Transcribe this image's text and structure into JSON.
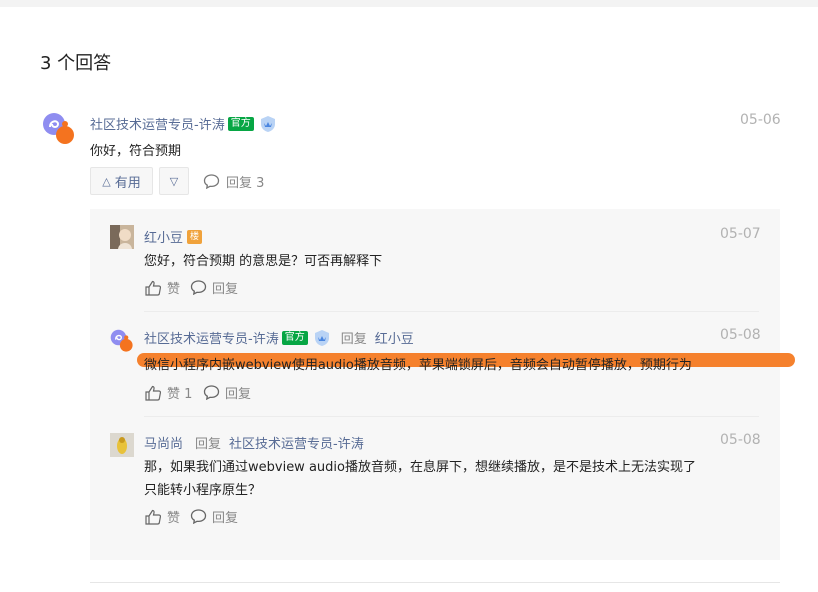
{
  "header": {
    "answer_count": "3 个回答"
  },
  "answer": {
    "author": "社区技术运营专员-许涛",
    "badge": "官方",
    "date": "05-06",
    "content": "你好，符合预期",
    "useful_label": "有用",
    "reply_label": "回复 3"
  },
  "replies": [
    {
      "author": "红小豆",
      "badge": "楼",
      "date": "05-07",
      "content": "您好，符合预期 的意思是？可否再解释下",
      "like_label": "赞",
      "reply_label": "回复"
    },
    {
      "author": "社区技术运营专员-许涛",
      "badge": "官方",
      "reply_word": "回复",
      "reply_to": "红小豆",
      "date": "05-08",
      "content": "微信小程序内嵌webview使用audio播放音频，苹果端锁屏后，音频会自动暂停播放，预期行为",
      "like_label": "赞 1",
      "reply_label": "回复"
    },
    {
      "author": "马尚尚",
      "reply_word": "回复",
      "reply_to": "社区技术运营专员-许涛",
      "date": "05-08",
      "content_line1": "那，如果我们通过webview audio播放音频，在息屏下，想继续播放，是不是技术上无法实现了",
      "content_line2": "只能转小程序原生？",
      "like_label": "赞",
      "reply_label": "回复"
    }
  ],
  "colors": {
    "link": "#576b95",
    "official_badge": "#07a644",
    "highlight": "#f47a22",
    "panel": "#f7f7f7"
  }
}
